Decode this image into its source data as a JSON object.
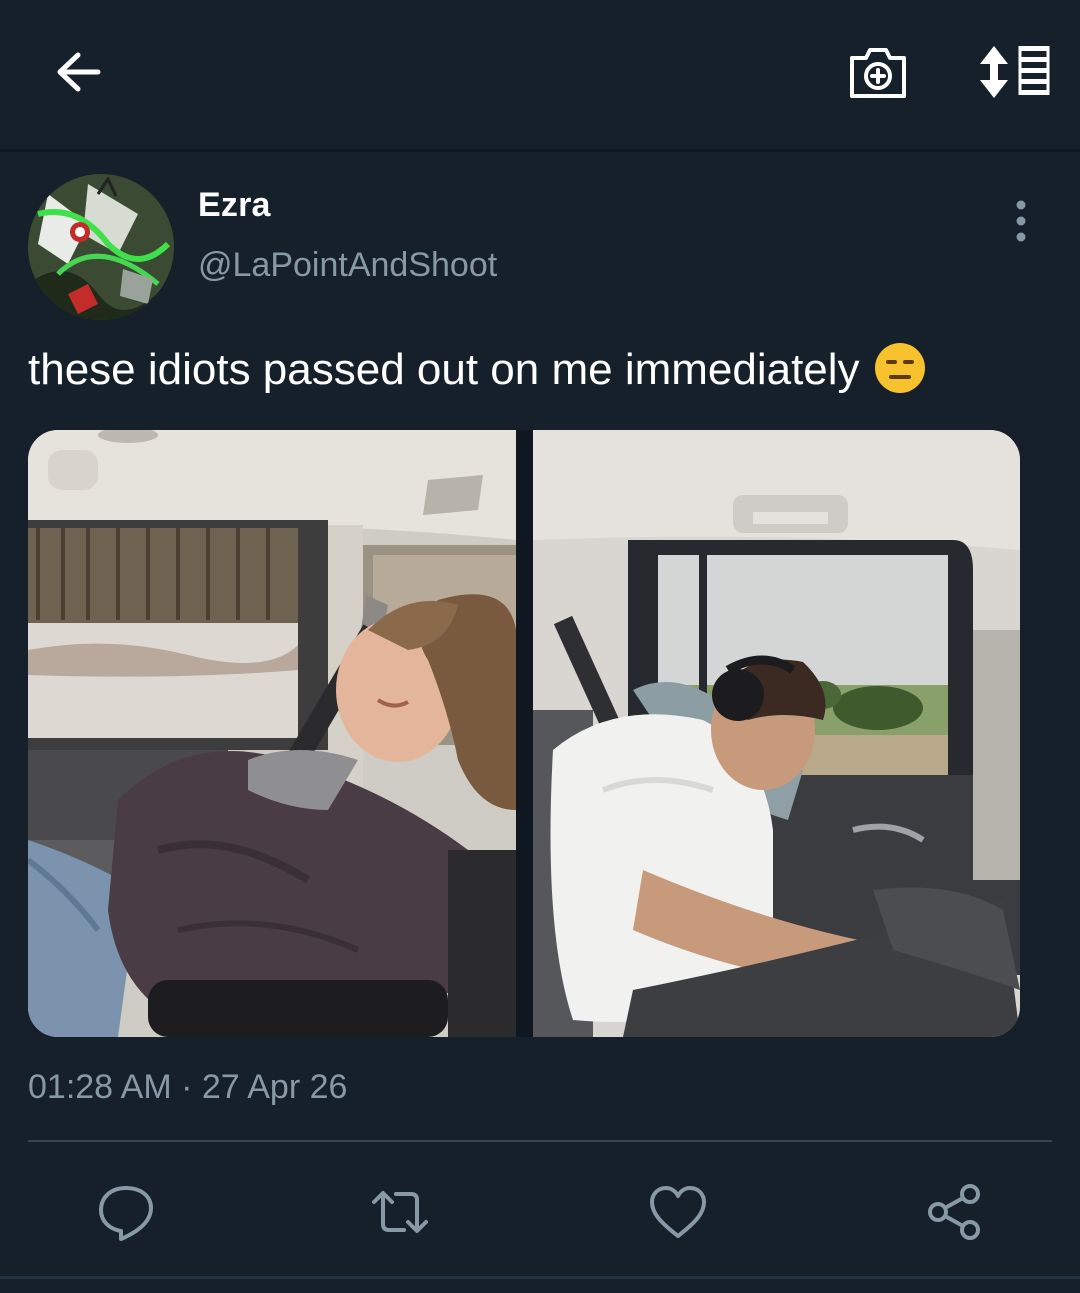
{
  "header": {
    "back_icon": "arrow-left-icon",
    "camera_icon": "camera-plus-icon",
    "sort_icon": "sort-list-icon"
  },
  "tweet": {
    "author": {
      "display_name": "Ezra",
      "handle": "@LaPointAndShoot"
    },
    "text": "these idiots passed out on me immediately",
    "emoji": "expressionless-face-emoji",
    "media": [
      {
        "name": "photo-left",
        "subject": "sleeping-passenger-in-car"
      },
      {
        "name": "photo-right",
        "subject": "sleeping-passenger-with-headphones"
      }
    ],
    "timestamp": "01:28 AM · 27 Apr 26"
  },
  "actions": {
    "reply_icon": "reply-icon",
    "retweet_icon": "retweet-icon",
    "like_icon": "heart-icon",
    "share_icon": "share-icon"
  },
  "colors": {
    "background": "#15202b",
    "secondary_text": "#8899a6",
    "divider": "#38444d"
  }
}
